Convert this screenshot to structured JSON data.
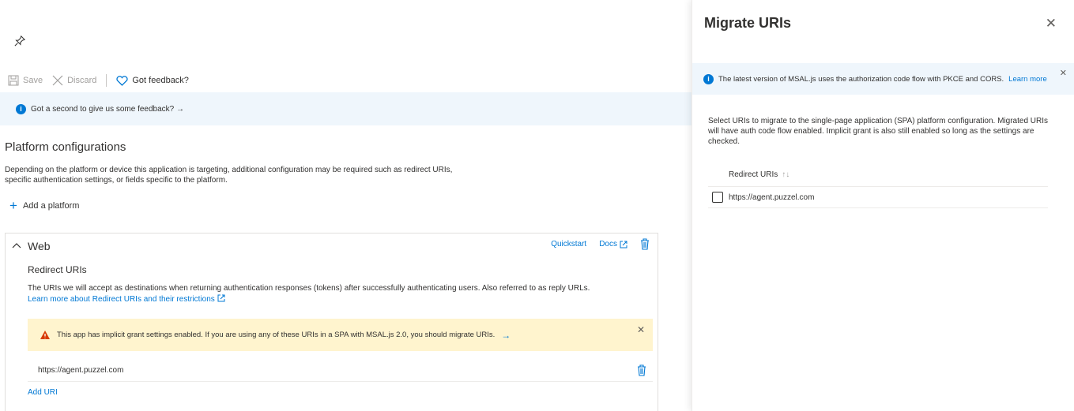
{
  "toolbar": {
    "save_label": "Save",
    "discard_label": "Discard",
    "feedback_label": "Got feedback?"
  },
  "feedback_bar": {
    "text": "Got a second to give us some feedback? →"
  },
  "platform": {
    "title": "Platform configurations",
    "description": "Depending on the platform or device this application is targeting, additional configuration may be required such as redirect URIs, specific authentication settings, or fields specific to the platform.",
    "add_label": "Add a platform"
  },
  "web_card": {
    "title": "Web",
    "quickstart_label": "Quickstart",
    "docs_label": "Docs",
    "redirect_title": "Redirect URIs",
    "redirect_description": "The URIs we will accept as destinations when returning authentication responses (tokens) after successfully authenticating users. Also referred to as reply URLs.",
    "redirect_link": "Learn more about Redirect URIs and their restrictions",
    "warning_text": "This app has implicit grant settings enabled. If you are using any of these URIs in a SPA with MSAL.js 2.0, you should migrate URIs.",
    "warning_arrow": "→",
    "uris": [
      "https://agent.puzzel.com"
    ],
    "add_uri_label": "Add URI"
  },
  "panel": {
    "title": "Migrate URIs",
    "info_text": "The latest version of MSAL.js uses the authorization code flow with PKCE and CORS.",
    "info_link": "Learn more",
    "description": "Select URIs to migrate to the single-page application (SPA) platform configuration. Migrated URIs will have auth code flow enabled. Implicit grant is also still enabled so long as the settings are checked.",
    "column_header": "Redirect URIs",
    "sort_glyph": "↑↓",
    "rows": [
      "https://agent.puzzel.com"
    ]
  },
  "colors": {
    "accent": "#0078d4",
    "info_bg": "#eff6fc",
    "warning_bg": "#fff4ce",
    "warning_icon": "#d83b01"
  }
}
